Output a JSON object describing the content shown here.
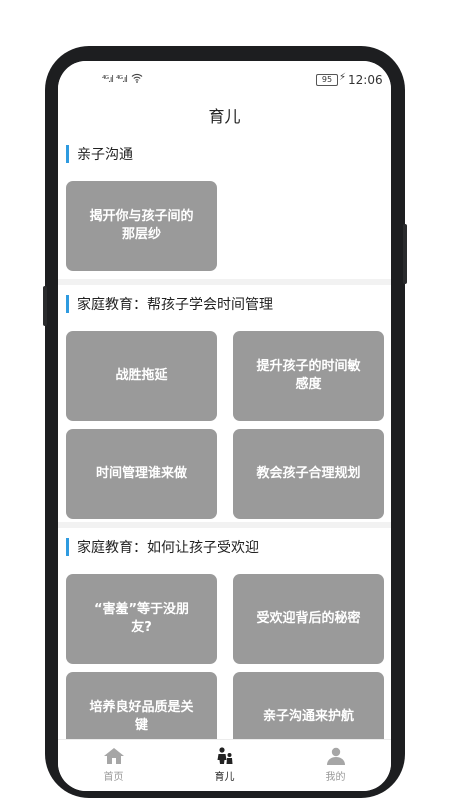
{
  "status_bar": {
    "signal_1": "⁴ᴳ.ıl",
    "signal_2": "⁴ᴳ.ıl",
    "battery": "95",
    "time": "12:06"
  },
  "header": {
    "title": "育儿"
  },
  "sections": [
    {
      "title": "亲子沟通",
      "cards": [
        "揭开你与孩子间的那层纱"
      ]
    },
    {
      "title": "家庭教育：帮孩子学会时间管理",
      "cards": [
        "战胜拖延",
        "提升孩子的时间敏感度",
        "时间管理谁来做",
        "教会孩子合理规划"
      ]
    },
    {
      "title": "家庭教育：如何让孩子受欢迎",
      "cards": [
        "“害羞”等于没朋友?",
        "受欢迎背后的秘密",
        "培养良好品质是关键",
        "亲子沟通来护航"
      ]
    }
  ],
  "tabbar": {
    "tabs": [
      {
        "label": "首页",
        "icon": "home-icon"
      },
      {
        "label": "育儿",
        "icon": "parenting-icon",
        "active": true
      },
      {
        "label": "我的",
        "icon": "profile-icon"
      }
    ]
  },
  "colors": {
    "accent": "#2f9be0",
    "card": "#9a9a9a",
    "background": "#f2f2f2"
  }
}
